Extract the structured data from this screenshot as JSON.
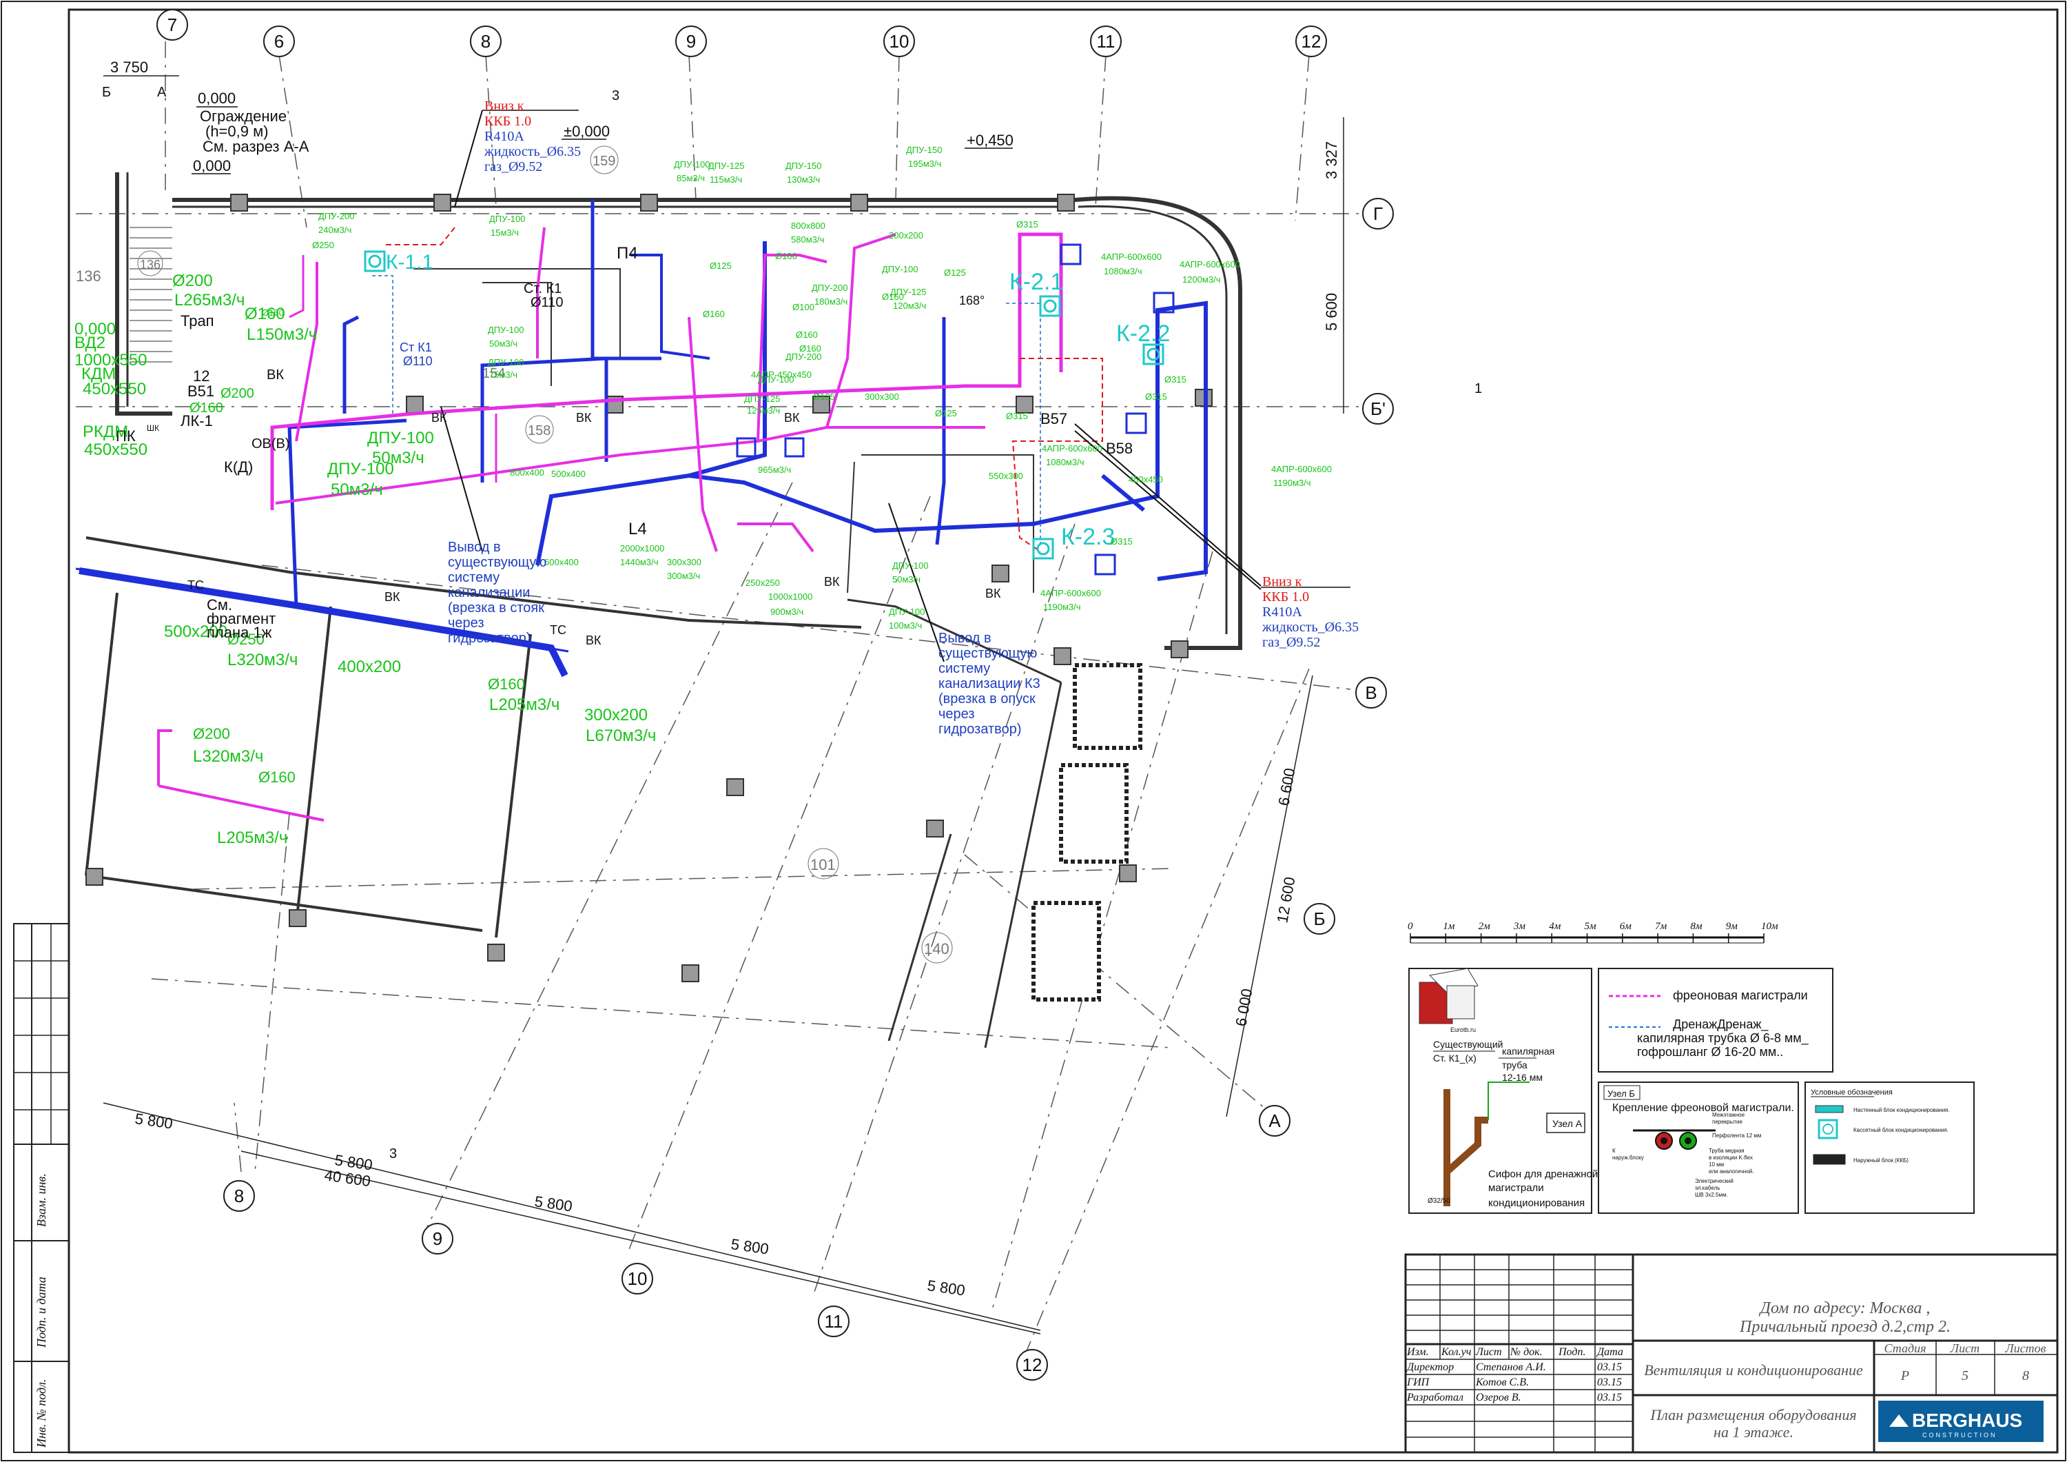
{
  "axes": {
    "top": [
      "7",
      "6",
      "8",
      "9",
      "10",
      "11",
      "12"
    ],
    "right": [
      "Г",
      "Б'",
      "В",
      "Б",
      "А"
    ],
    "bottom": [
      "8",
      "9",
      "10",
      "11",
      "12"
    ]
  },
  "dims": {
    "d3750": "3 750",
    "d3327": "3 327",
    "d5600": "5 600",
    "d6600": "6 600",
    "d12600": "12 600",
    "d6000": "6 000",
    "d5800a": "5 800",
    "d5800b": "5 800",
    "d5800c": "5 800",
    "d5800d": "5 800",
    "d5800e": "5 800",
    "d40600": "40 600"
  },
  "levels": {
    "l1": "0,000",
    "l2": "0,000",
    "l3": "±0,000",
    "l4": "+0,450",
    "l5": "0,000"
  },
  "notes": {
    "fence1": "Ограждение",
    "fence2": "(h=0,9 м)",
    "fence3": "См. разрез А-А",
    "section_b": "Б",
    "section_a": "А",
    "section_3": "3",
    "section_1": "1"
  },
  "rooms": {
    "r136": "136",
    "r136b": "136",
    "r159": "159",
    "r158": "158",
    "r154": "154",
    "r101": "101",
    "r140": "140"
  },
  "units": {
    "k11": "К-1.1",
    "k21": "К-2.1",
    "k22": "К-2.2",
    "k23": "К-2.3",
    "p4": "П4",
    "l4": "L4",
    "b57": "В57",
    "b58": "В58",
    "b51": "В51",
    "b12": "12",
    "trap": "Трап",
    "pk": "ПК",
    "lk1": "ЛК-1",
    "kd": "К(Д)",
    "ovb": "ОВ(В)",
    "vk1": "ВК",
    "vk2": "ВК",
    "vk3": "ВК",
    "vk4": "ВК",
    "vk5": "ВК",
    "vk6": "ВК",
    "vk7": "ВК",
    "vk8": "ВК",
    "tc1": "ТС",
    "tc2": "ТС",
    "shk": "ШК",
    "angle": "168°"
  },
  "freon": [
    {
      "l1": "Вниз к",
      "l2": "ККБ 1.0",
      "l3": "R410A",
      "l4": "жидкость_Ø6.35",
      "l5": "газ_Ø9.52"
    },
    {
      "l1": "Вниз к",
      "l2": "ККБ 1.0",
      "l3": "R410A",
      "l4": "жидкость_Ø6.35",
      "l5": "газ_Ø9.52"
    }
  ],
  "small_green": [
    "ДПУ-200",
    "240м3/ч",
    "ДПУ-100",
    "15м3/ч",
    "ДПУ-100",
    "85м3/ч",
    "ДПУ-125",
    "115м3/ч",
    "ДПУ-150",
    "130м3/ч",
    "ДПУ-150",
    "195м3/ч",
    "800х800",
    "580м3/ч",
    "200х200",
    "ДПУ-100",
    "ДПУ-200",
    "180м3/ч",
    "ДПУ-125",
    "120м3/ч",
    "ДПУ-200",
    "ДПУ-100",
    "50м3/ч",
    "ДПУ-100",
    "75м3/ч",
    "4АПР-450х450",
    "965м3/ч",
    "ДПУ-100",
    "ДПУ-125",
    "125м3/ч",
    "2000х1000",
    "1440м3/ч",
    "300х300",
    "300м3/ч",
    "250х250",
    "1000х1000",
    "900м3/ч",
    "ДПУ-100",
    "50м3/ч",
    "ДПУ-100",
    "100м3/ч",
    "600х400",
    "500х400",
    "800х400",
    "300х300",
    "550х300",
    "4АПР-600х600",
    "1080м3/ч",
    "4АПР-600х600",
    "1200м3/ч",
    "4АПР-600х600",
    "1190м3/ч",
    "4АПР-600х600",
    "1080м3/ч",
    "4АПР-600х600",
    "1190м3/ч",
    "450х450",
    "Ø315",
    "Ø315",
    "Ø315",
    "Ø315",
    "Ø315",
    "Ø125",
    "Ø160",
    "Ø100",
    "Ø160",
    "Ø125",
    "Ø160",
    "Ø125",
    "Ø160",
    "Ø100",
    "Ø125",
    "Ø250",
    "Ø160"
  ],
  "big_green": {
    "g1": "Ø200",
    "g2": "L265м3/ч",
    "g3": "ВД2",
    "g4": "1000х550",
    "g5": "КДМ",
    "g6": "450х550",
    "g7": "РКДМ",
    "g8": "450х550",
    "g9": "Ø160",
    "g10": "L150м3/ч",
    "g11": "Ø200",
    "g12": "Ø160",
    "g13": "ДПУ-100",
    "g14": "50м3/ч",
    "g15": "ДПУ-100",
    "g16": "50м3/ч",
    "g17": "500х200",
    "g18": "Ø250",
    "g19": "L320м3/ч",
    "g20": "400х200",
    "g21": "Ø160",
    "g22": "L205м3/ч",
    "g23": "300х200",
    "g24": "L670м3/ч",
    "g25": "Ø200",
    "g26": "L320м3/ч",
    "g27": "Ø160",
    "g28": "L205м3/ч",
    "g29": "0,000"
  },
  "blue_notes": {
    "stk1a": "Ст. К1",
    "stk1b": "Ø110",
    "stk1c": "Ст К1",
    "stk1d": "Ø110",
    "out1": [
      "Вывод в",
      "существующую",
      "систему",
      "канализации",
      "(врезка в стояк",
      "через",
      "гидрозатвор)"
    ],
    "out2": [
      "Вывод в",
      "существующую",
      "систему",
      "канализации К3",
      "(врезка в опуск",
      "через",
      "гидрозатвор)"
    ]
  },
  "frag": [
    "См.",
    "фрагмент",
    "плана 1ж"
  ],
  "scale": {
    "labels": [
      "0",
      "1м",
      "2м",
      "3м",
      "4м",
      "5м",
      "6м",
      "7м",
      "8м",
      "9м",
      "10м"
    ]
  },
  "legend": {
    "freon": "фреоновая магистрали",
    "drain1": "ДренажДренаж_",
    "drain2": "капилярная трубка Ø 6-8 мм_",
    "drain3": "гофрошланг Ø 16-20 мм.."
  },
  "siphon": {
    "site": "Eurotb.ru",
    "existing": "Существующий",
    "stk": "Ст. К1_(х)",
    "cap1": "капилярная",
    "cap2": "труба",
    "cap3": "12-16 мм",
    "node": "Узел А",
    "title1": "Сифон для дренажной",
    "title2": "магистрали",
    "title3": "кондиционирования",
    "size": "Ø32/50"
  },
  "nodeB": {
    "tag": "Узел Б",
    "title": "Крепление фреоновой магистрали.",
    "n1": "Межэтажное",
    "n2": "перекрытие",
    "n3": "Перфолента 12 мм",
    "n4": "Труба медная",
    "n5": "в изоляции K-flex",
    "n6": "10 мм",
    "n7": "или аналогичной.",
    "n8": "Электрический",
    "n9": "эл.кабель",
    "n10": "ШВ 3х2.5мм.",
    "n11": "К",
    "n12": "наруж.блоку"
  },
  "symbols": {
    "title": "Условные обозначения",
    "s1": "Настенный блок кондиционирования.",
    "s2": "Кассетный блок кондиционирования.",
    "s3": "Наружный блок (ККБ)"
  },
  "stamp": {
    "cols": [
      "Изм.",
      "Кол.уч",
      "Лист",
      "№ док.",
      "Подп.",
      "Дата"
    ],
    "rows": [
      {
        "role": "Директор",
        "name": "Степанов А.И.",
        "date": "03.15"
      },
      {
        "role": "ГИП",
        "name": "Котов С.В.",
        "date": "03.15"
      },
      {
        "role": "Разработал",
        "name": "Озеров В.",
        "date": "03.15"
      }
    ],
    "addr1": "Дом  по адресу: Москва ,",
    "addr2": "Причальный проезд д.2,стр 2.",
    "section": "Вентиляция и кондиционирование",
    "plan1": "План размещения оборудования",
    "plan2": "на  1 этаже.",
    "stage_h": "Стадия",
    "sheet_h": "Лист",
    "sheets_h": "Листов",
    "stage": "Р",
    "sheet": "5",
    "sheets": "8",
    "logo": "BERGHAUS",
    "logo_sub": "CONSTRUCTION"
  },
  "side": {
    "s1": "Взам. инв.",
    "s2": "Подп. и дата",
    "s3": "Инв. № подл."
  },
  "colors": {
    "magenta": "#e62fe6",
    "blue": "#1f2fd8",
    "green": "#18c418",
    "red": "#e01818",
    "cyan": "#1fc8c8",
    "brand": "#0b5f9a"
  }
}
